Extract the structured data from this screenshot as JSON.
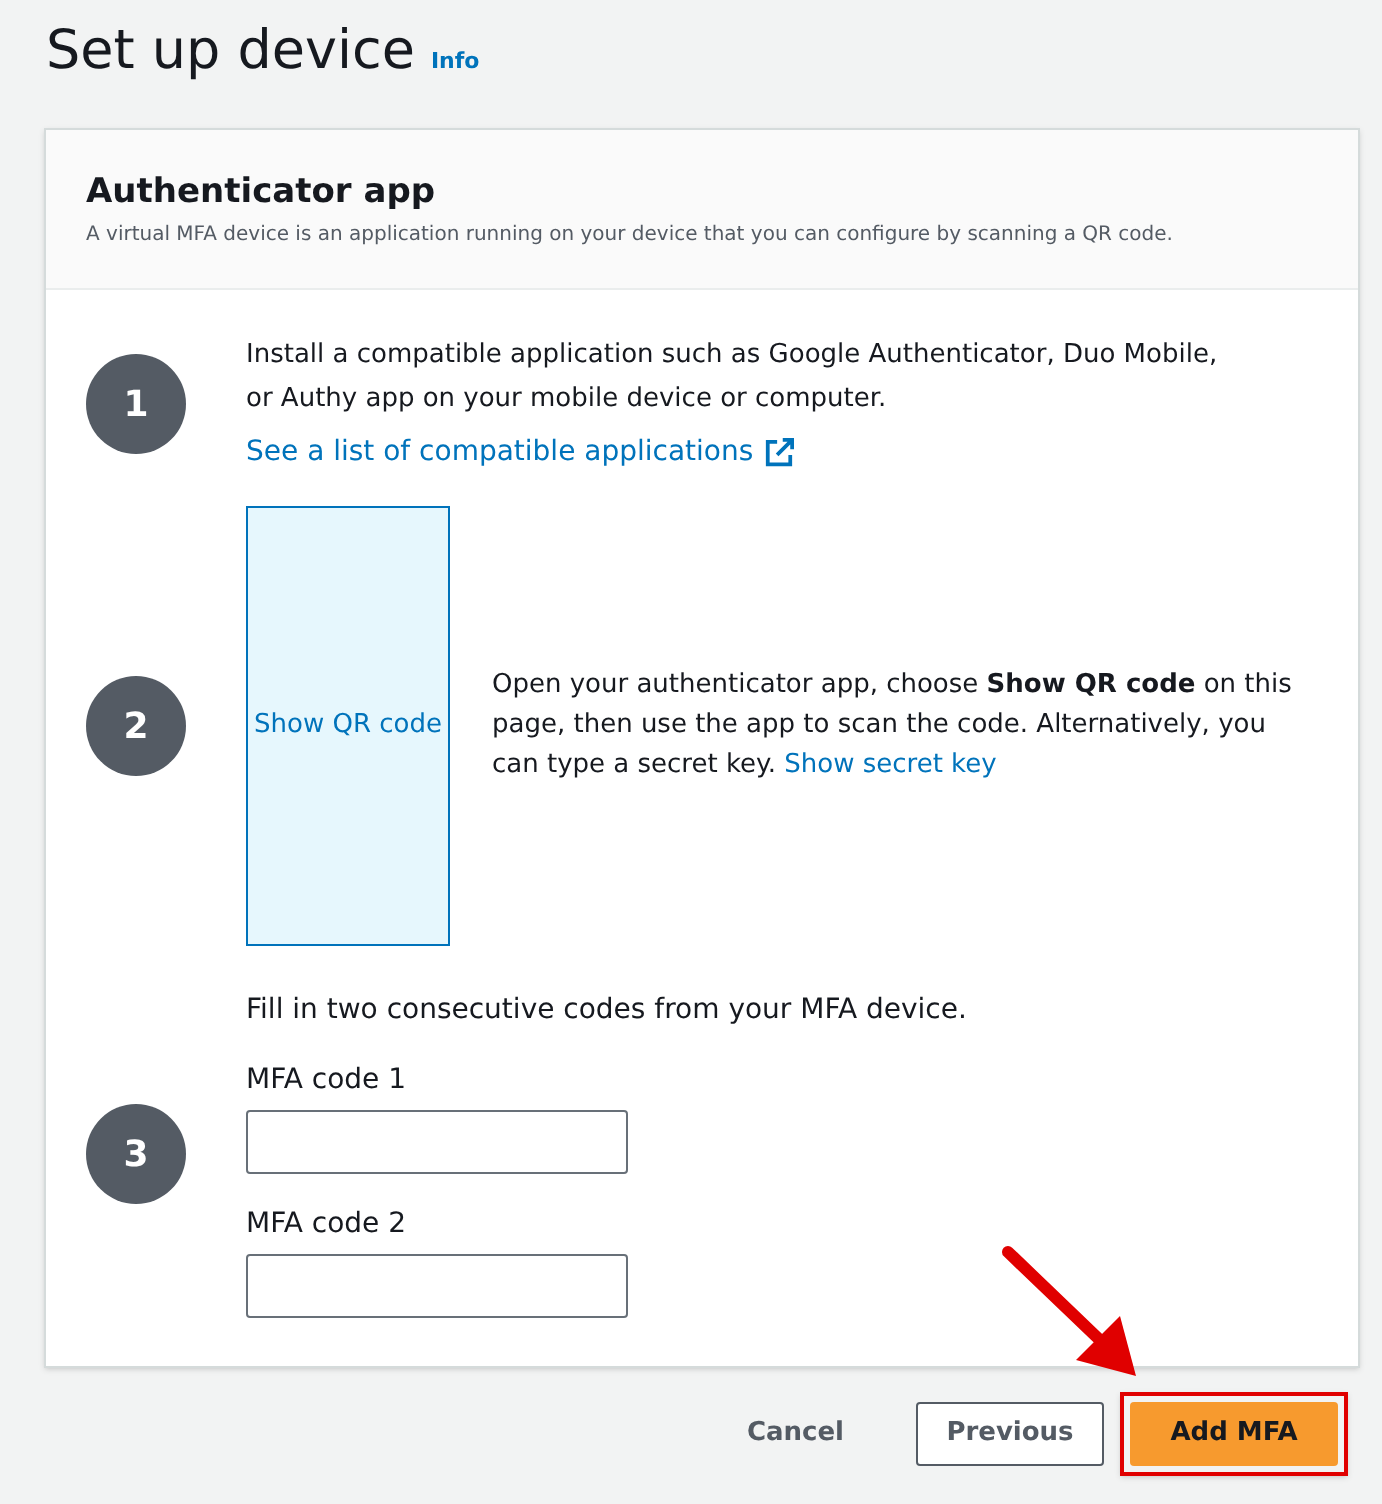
{
  "page": {
    "title": "Set up device",
    "info_link": "Info"
  },
  "card": {
    "title": "Authenticator app",
    "description": "A virtual MFA device is an application running on your device that you can configure by scanning a QR code."
  },
  "steps": [
    {
      "kind": "install",
      "number": "1",
      "text": "Install a compatible application such as Google Authenticator, Duo Mobile, or Authy app on your mobile device or computer.",
      "link": "See a list of compatible applications"
    },
    {
      "kind": "qr",
      "number": "2",
      "qr_button": "Show QR code",
      "text": "Open your authenticator app, choose **Show QR code** on this page, then use the app to scan the code. Alternatively, you can type a secret key.",
      "link": "Show secret key"
    },
    {
      "kind": "codes",
      "number": "3",
      "text": "Fill in two consecutive codes from your MFA device.",
      "fields": [
        {
          "label": "MFA code 1"
        },
        {
          "label": "MFA code 2"
        }
      ]
    }
  ],
  "footer": {
    "cancel": "Cancel",
    "previous": "Previous",
    "submit": "Add MFA",
    "submit_highlighted": true
  }
}
